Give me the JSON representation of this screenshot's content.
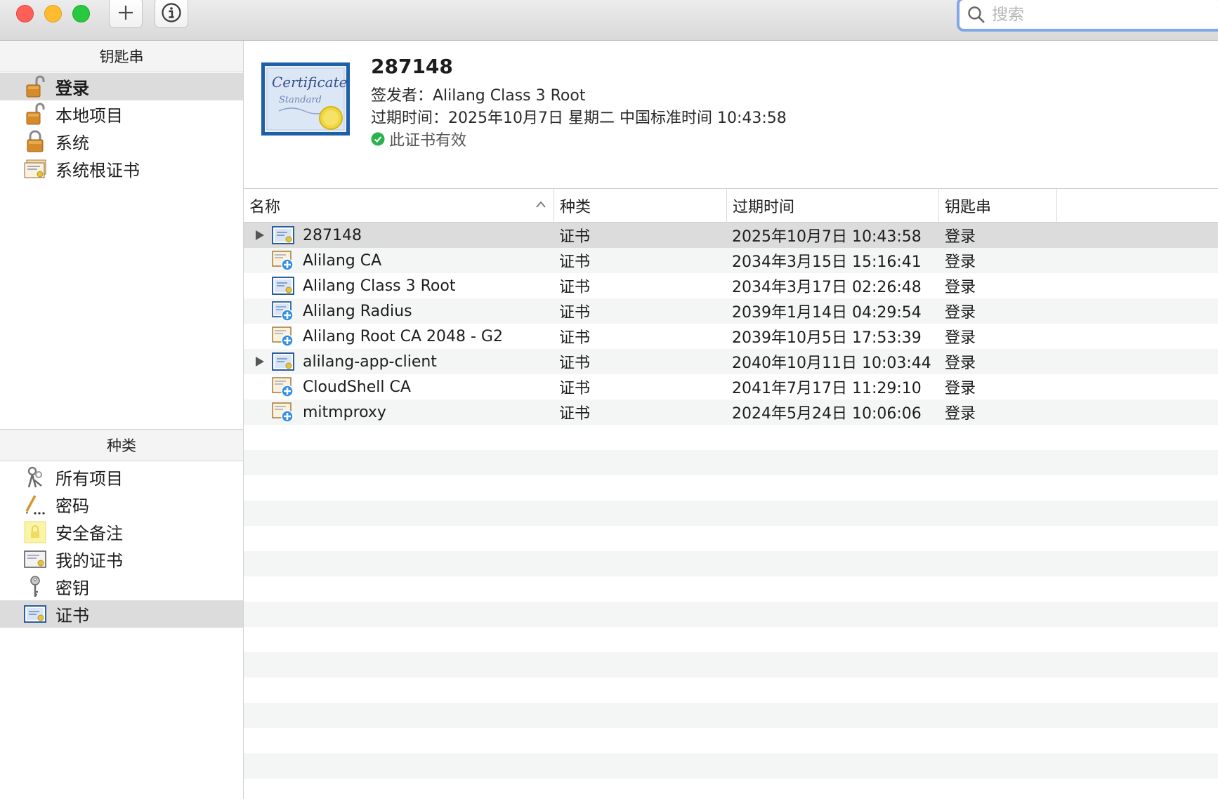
{
  "toolbar": {
    "add_label": "+",
    "search_placeholder": "搜索"
  },
  "sidebar": {
    "keychains_header": "钥匙串",
    "keychains": [
      {
        "label": "登录",
        "icon": "unlocked-padlock-icon",
        "selected": true
      },
      {
        "label": "本地项目",
        "icon": "unlocked-padlock-icon"
      },
      {
        "label": "系统",
        "icon": "locked-padlock-icon"
      },
      {
        "label": "系统根证书",
        "icon": "certificate-stack-icon"
      }
    ],
    "categories_header": "种类",
    "categories": [
      {
        "label": "所有项目",
        "icon": "all-items-icon"
      },
      {
        "label": "密码",
        "icon": "password-icon"
      },
      {
        "label": "安全备注",
        "icon": "secure-note-icon"
      },
      {
        "label": "我的证书",
        "icon": "my-certificate-icon"
      },
      {
        "label": "密钥",
        "icon": "key-icon"
      },
      {
        "label": "证书",
        "icon": "certificate-icon",
        "selected": true
      }
    ]
  },
  "detail": {
    "title": "287148",
    "issuer": "签发者：Alilang Class 3 Root",
    "expiry": "过期时间：2025年10月7日 星期二 中国标准时间 10:43:58",
    "status": "此证书有效",
    "status_color": "#2bb24c"
  },
  "table": {
    "columns": [
      "名称",
      "种类",
      "过期时间",
      "钥匙串"
    ],
    "rows": [
      {
        "name": "287148",
        "kind": "证书",
        "expires": "2025年10月7日 10:43:58",
        "keychain": "登录",
        "expandable": true,
        "icon": "certificate-icon",
        "selected": true
      },
      {
        "name": "Alilang CA",
        "kind": "证书",
        "expires": "2034年3月15日 15:16:41",
        "keychain": "登录",
        "icon": "root-certificate-icon"
      },
      {
        "name": "Alilang Class 3 Root",
        "kind": "证书",
        "expires": "2034年3月17日 02:26:48",
        "keychain": "登录",
        "icon": "certificate-icon"
      },
      {
        "name": "Alilang Radius",
        "kind": "证书",
        "expires": "2039年1月14日 04:29:54",
        "keychain": "登录",
        "icon": "certificate-plus-icon"
      },
      {
        "name": "Alilang Root CA 2048 - G2",
        "kind": "证书",
        "expires": "2039年10月5日 17:53:39",
        "keychain": "登录",
        "icon": "root-certificate-icon"
      },
      {
        "name": "alilang-app-client",
        "kind": "证书",
        "expires": "2040年10月11日 10:03:44",
        "keychain": "登录",
        "expandable": true,
        "icon": "certificate-icon"
      },
      {
        "name": "CloudShell CA",
        "kind": "证书",
        "expires": "2041年7月17日 11:29:10",
        "keychain": "登录",
        "icon": "root-certificate-icon"
      },
      {
        "name": "mitmproxy",
        "kind": "证书",
        "expires": "2024年5月24日 10:06:06",
        "keychain": "登录",
        "icon": "root-certificate-icon"
      }
    ]
  }
}
